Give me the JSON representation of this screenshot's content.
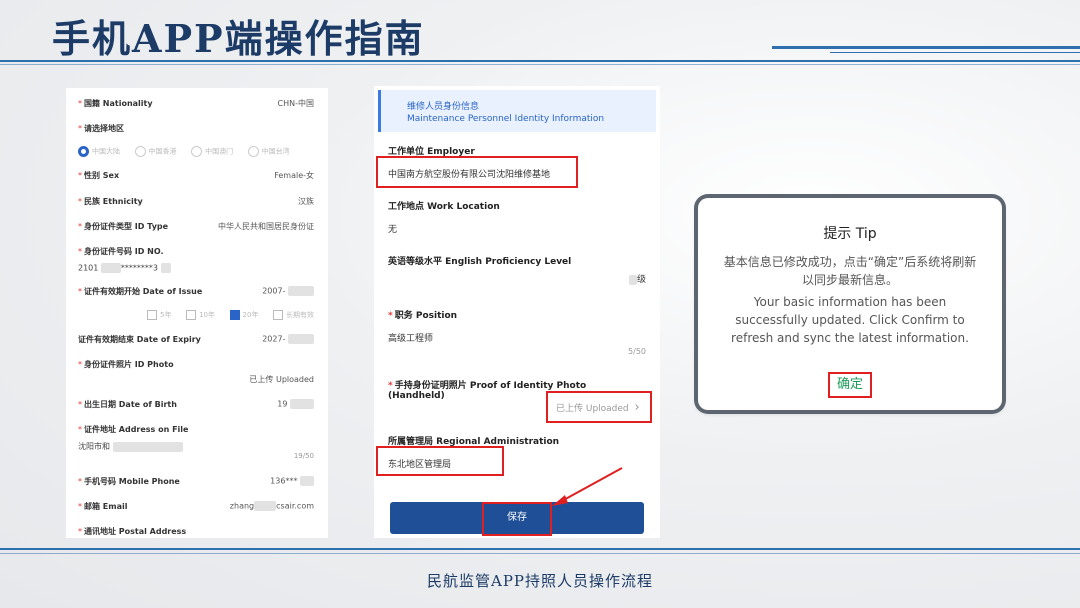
{
  "page": {
    "title": "手机APP端操作指南",
    "footer": "民航监管APP持照人员操作流程"
  },
  "left_form": {
    "nationality_label": "国籍 Nationality",
    "nationality_value": "CHN-中国",
    "region_label": "请选择地区",
    "region_options": [
      "中国大陆",
      "中国香港",
      "中国澳门",
      "中国台湾"
    ],
    "sex_label": "性别 Sex",
    "sex_value": "Female-女",
    "ethnicity_label": "民族 Ethnicity",
    "ethnicity_value": "汉族",
    "idtype_label": "身份证件类型 ID Type",
    "idtype_value": "中华人民共和国居民身份证",
    "idno_label": "身份证件号码 ID NO.",
    "idno_value_a": "2101",
    "idno_value_b": "********3",
    "issue_label": "证件有效期开始 Date of Issue",
    "issue_value": "2007-",
    "validity_options": [
      "5年",
      "10年",
      "20年",
      "长期有效"
    ],
    "expiry_label": "证件有效期结束 Date of Expiry",
    "expiry_value": "2027-",
    "photo_label": "身份证件照片 ID Photo",
    "photo_value": "已上传 Uploaded",
    "dob_label": "出生日期 Date of Birth",
    "dob_value": "19",
    "address_label": "证件地址 Address on File",
    "address_value": "沈阳市和",
    "address_counter": "19/50",
    "mobile_label": "手机号码 Mobile Phone",
    "mobile_value": "136***",
    "email_label": "邮箱 Email",
    "email_value_a": "zhang",
    "email_value_b": "csair.com",
    "postal_label": "通讯地址 Postal Address"
  },
  "mid_form": {
    "section_zh": "维修人员身份信息",
    "section_en": "Maintenance Personnel Identity Information",
    "employer_label": "工作单位 Employer",
    "employer_value": "中国南方航空股份有限公司沈阳维修基地",
    "location_label": "工作地点 Work Location",
    "location_value": "无",
    "english_label": "英语等级水平 English Proficiency Level",
    "english_value": "级",
    "position_label": "职务 Position",
    "position_value": "高级工程师",
    "position_counter": "5/50",
    "proof_label": "手持身份证明照片 Proof of Identity Photo (Handheld)",
    "proof_value": "已上传 Uploaded",
    "proof_chevron": "›",
    "admin_label": "所属管理局 Regional Administration",
    "admin_value": "东北地区管理局",
    "save_button": "保存"
  },
  "dialog": {
    "title": "提示 Tip",
    "message_zh": "基本信息已修改成功，点击“确定”后系统将刷新以同步最新信息。",
    "message_en": "Your basic information has been successfully updated. Click Confirm to refresh and sync the latest information.",
    "confirm_button": "确定"
  },
  "colors": {
    "title_navy": "#1c3b66",
    "accent_blue": "#2f6fb0",
    "save_button_bg": "#1f4f97",
    "highlight_red": "#e02020",
    "confirm_green": "#1e9c5a"
  },
  "icons": [
    "chevron-right-icon",
    "arrow-annotation-icon"
  ]
}
